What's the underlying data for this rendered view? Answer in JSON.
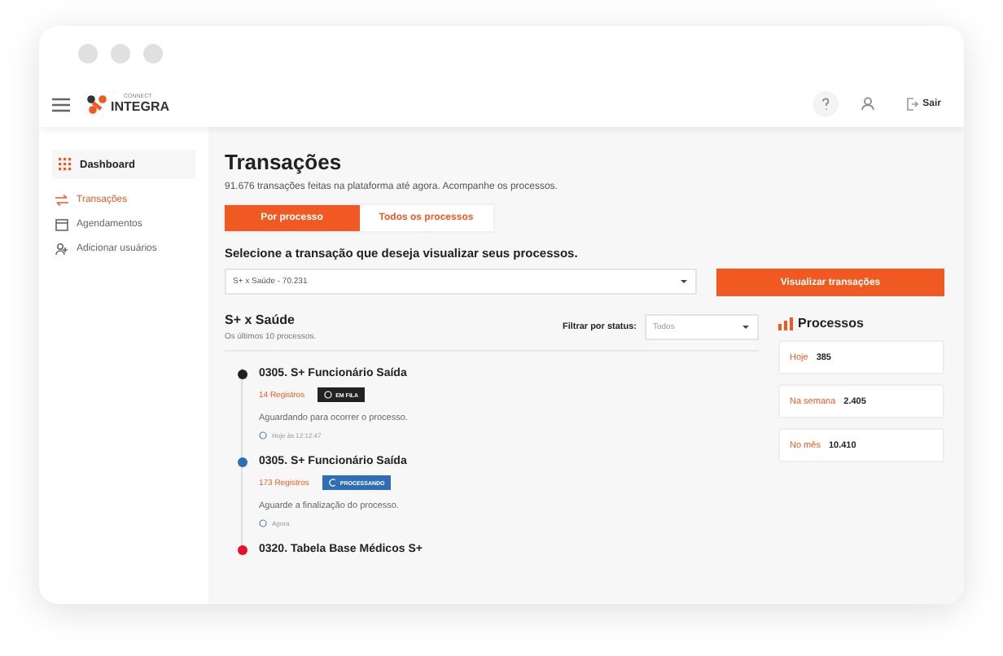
{
  "header": {
    "logo_small": "CONNECT",
    "logo": "INTEGRA",
    "logout": "Sair"
  },
  "sidebar": {
    "items": [
      {
        "label": "Dashboard",
        "selected": false,
        "kind": "section"
      },
      {
        "label": "Transações",
        "selected": true,
        "kind": "link"
      },
      {
        "label": "Agendamentos",
        "selected": false,
        "kind": "link"
      },
      {
        "label": "Adicionar usuários",
        "selected": false,
        "kind": "link"
      }
    ]
  },
  "page": {
    "title": "Transações",
    "subtitle": "91.676 transações feitas na plataforma até agora. Acompanhe os processos.",
    "tabs": [
      {
        "label": "Por processo",
        "selected": true
      },
      {
        "label": "Todos os processos",
        "selected": false
      }
    ],
    "select_label": "Selecione a transação que deseja visualizar seus processos.",
    "select_value": "S+ x Saúde - 70.231",
    "button": "Visualizar transações"
  },
  "processes": {
    "title": "S+ x Saúde",
    "subtitle": "Os últimos 10 processos.",
    "filter_label": "Filtrar por status:",
    "filter_value": "Todos",
    "items": [
      {
        "title": "0305. S+ Funcionário Saída",
        "color": "#222222",
        "records": "14 Registros",
        "status": "EM FILA",
        "kind": "queued",
        "description": "Aguardando para ocorrer o processo.",
        "time": "Hoje às 12:12:47"
      },
      {
        "title": "0305. S+ Funcionário Saída",
        "color": "#2f6db5",
        "records": "173 Registros",
        "status": "PROCESSANDO",
        "kind": "processing",
        "description": "Aguarde a finalização do processo.",
        "time": "Agora"
      },
      {
        "title": "0320. Tabela Base Médicos S+",
        "color": "#e8102a"
      }
    ]
  },
  "stats": {
    "title": "Processos",
    "items": [
      {
        "label": "Hoje",
        "value": "385"
      },
      {
        "label": "Na semana",
        "value": "2.405"
      },
      {
        "label": "No mês",
        "value": "10.410"
      }
    ]
  }
}
